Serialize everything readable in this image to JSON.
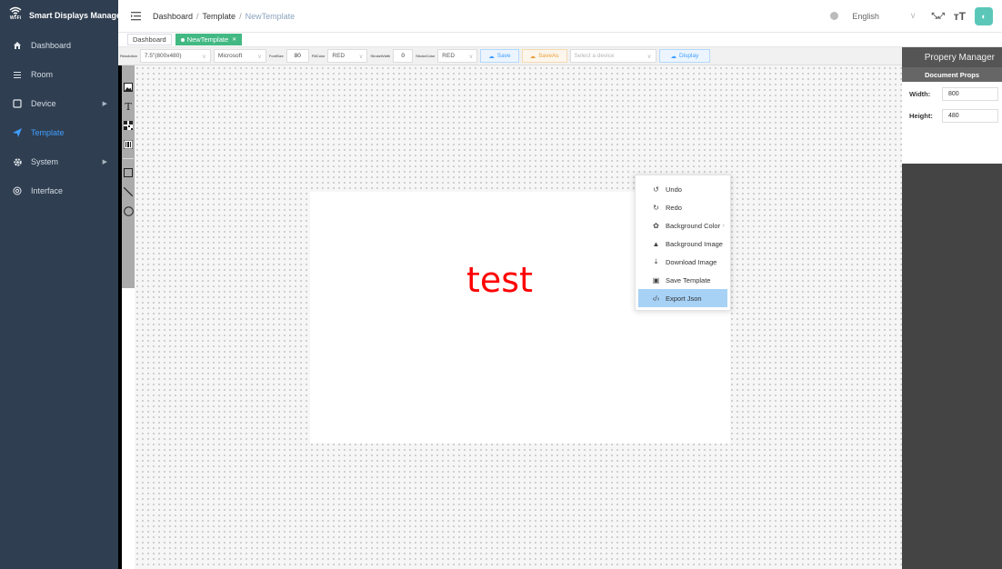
{
  "app": {
    "title": "Smart Displays Manager",
    "logo_text": "Wi-Fi"
  },
  "sidebar": {
    "items": [
      {
        "label": "Dashboard",
        "icon": "home-icon"
      },
      {
        "label": "Room",
        "icon": "list-icon"
      },
      {
        "label": "Device",
        "icon": "tablet-icon"
      },
      {
        "label": "Template",
        "icon": "send-icon"
      },
      {
        "label": "System",
        "icon": "gear-icon"
      },
      {
        "label": "Interface",
        "icon": "globe-icon"
      }
    ],
    "active": "Template"
  },
  "header": {
    "breadcrumb": [
      "Dashboard",
      "Template",
      "NewTemplate"
    ],
    "language": "English"
  },
  "tabs": [
    {
      "label": "Dashboard"
    },
    {
      "label": "NewTemplate"
    }
  ],
  "toolbar": {
    "resolution_label": "Resolution",
    "resolution_value": "7.5\"(800x480)",
    "font_family_value": "Microsoft",
    "font_size_label": "FontSize",
    "font_size_value": "80",
    "fill_color_label": "FillColor",
    "fill_color_value": "RED",
    "stroke_width_label": "StrokeWidth",
    "stroke_width_value": "0",
    "stroke_color_label": "StrokeColor",
    "stroke_color_value": "RED",
    "save_label": "Save",
    "saveas_label": "SaveAs",
    "device_placeholder": "Select a device",
    "display_label": "Display"
  },
  "canvas": {
    "text": "test",
    "text_color": "#ff0000"
  },
  "context_menu": {
    "items": [
      {
        "label": "Undo",
        "icon": "undo-icon"
      },
      {
        "label": "Redo",
        "icon": "redo-icon"
      },
      {
        "label": "Background Color",
        "icon": "palette-icon"
      },
      {
        "label": "Background Image",
        "icon": "image-icon"
      },
      {
        "label": "Download Image",
        "icon": "download-icon"
      },
      {
        "label": "Save Template",
        "icon": "save-icon"
      },
      {
        "label": "Export Json",
        "icon": "code-icon"
      }
    ],
    "highlighted": "Export Json"
  },
  "property_manager": {
    "title": "Propery Manager",
    "section": "Document Props",
    "width_label": "Width:",
    "width_value": "800",
    "height_label": "Height:",
    "height_value": "480"
  },
  "colors": {
    "sidebar_bg": "#2f3e50",
    "accent": "#409eff",
    "tab_active": "#42b983",
    "saveas": "#e6a23c"
  }
}
